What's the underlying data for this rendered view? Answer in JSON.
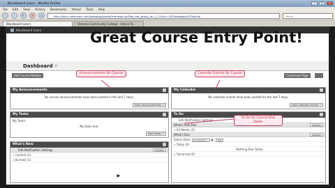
{
  "browser": {
    "title": "Blackboard Learn - Mozilla Firefox",
    "menu": [
      "File",
      "Edit",
      "View",
      "History",
      "Bookmarks",
      "Yahoo!",
      "Tools",
      "Help"
    ],
    "url": "http://learn.valenciacc.edu/webapps/portal/frameset.jsp?tab_tab_group_id=_2_1&url=%2Fwebapps%2Fblackb",
    "search_placeholder": "Yahoo",
    "tabs": [
      "Blackboard Learn",
      "Valencia Community College - Online To..."
    ]
  },
  "app": {
    "header_label": "Blackboard Learn",
    "slide_title": "Great Course Entry Point!",
    "dashboard_title": "Dashboard",
    "add_module_label": "Add Course Module",
    "customize_label": "Customize Page"
  },
  "panels": {
    "announcements": {
      "title": "My Announcements",
      "body": "No course announcements have been posted in the last 7 days.",
      "more": "more announcements →"
    },
    "tasks": {
      "title": "My Tasks",
      "subhead": "My Tasks:",
      "body": "No tasks due.",
      "more": "more tasks →"
    },
    "whatsnew": {
      "title": "What's New",
      "notif": "Edit Notification Settings",
      "actions": "Actions",
      "rows": [
        "» Content (1)",
        "» Journals (1)"
      ]
    },
    "calendar": {
      "title": "My Calendar",
      "body": "No calendar events have been posted for the last 7 days.",
      "more": "more calendar events →"
    },
    "todo": {
      "title": "To Do",
      "notif": "Edit Notification Settings",
      "past_due": "What's Past Due",
      "actions": "Actions",
      "all_weeks": "» All Weeks (0)",
      "whats_due": "What's Due",
      "select_date_label": "Select Date:",
      "date_value": "04/29/2011",
      "go": "Go",
      "today": "» Today (0)",
      "nothing_due": "Nothing Due Today",
      "tomorrow": "» Tomorrow (0)"
    }
  },
  "callouts": {
    "announcements": "Announcements for Course",
    "calendar": "Calendar Entries for Course",
    "todo": "To Do for Course Due Dates"
  },
  "colors": {
    "callout_border": "#c23a5a",
    "callout_text": "#c2243d",
    "panel_header": "#4a4a4a"
  }
}
